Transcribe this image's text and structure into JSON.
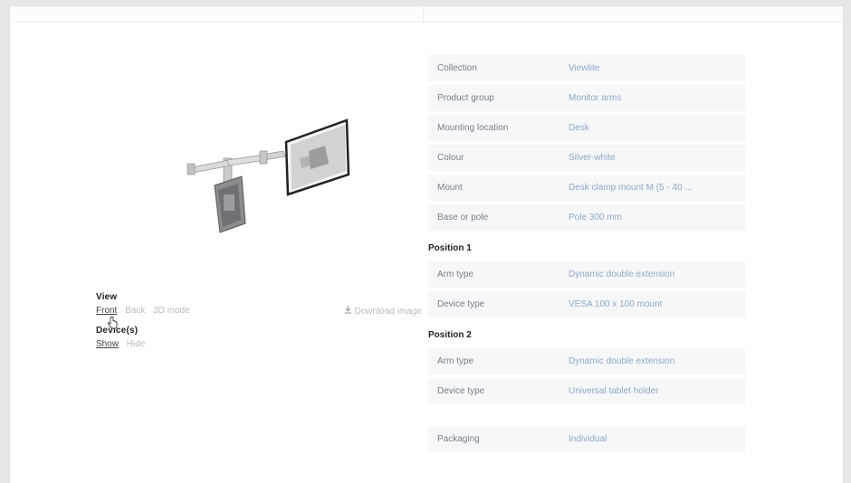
{
  "preview": {
    "image_name": "monitor-arm-render"
  },
  "view": {
    "heading": "View",
    "options": [
      {
        "label": "Front",
        "active": true
      },
      {
        "label": "Back",
        "active": false
      },
      {
        "label": "3D mode",
        "active": false
      }
    ],
    "download_label": "Download image"
  },
  "devices": {
    "heading": "Device(s)",
    "options": [
      {
        "label": "Show",
        "active": true
      },
      {
        "label": "Hide",
        "active": false
      }
    ]
  },
  "specs": {
    "general": [
      {
        "label": "Collection",
        "value": "Viewlite"
      },
      {
        "label": "Product group",
        "value": "Monitor arms"
      },
      {
        "label": "Mounting location",
        "value": "Desk"
      },
      {
        "label": "Colour",
        "value": "Silver-white"
      },
      {
        "label": "Mount",
        "value": "Desk clamp mount M (5 - 40 ..."
      },
      {
        "label": "Base or pole",
        "value": "Pole 300 mm"
      }
    ],
    "position1": {
      "title": "Position 1",
      "rows": [
        {
          "label": "Arm type",
          "value": "Dynamic double extension"
        },
        {
          "label": "Device type",
          "value": "VESA 100 x 100 mount"
        }
      ]
    },
    "position2": {
      "title": "Position 2",
      "rows": [
        {
          "label": "Arm type",
          "value": "Dynamic double extension"
        },
        {
          "label": "Device type",
          "value": "Universal tablet holder"
        }
      ]
    },
    "packaging": {
      "label": "Packaging",
      "value": "Individual"
    }
  }
}
